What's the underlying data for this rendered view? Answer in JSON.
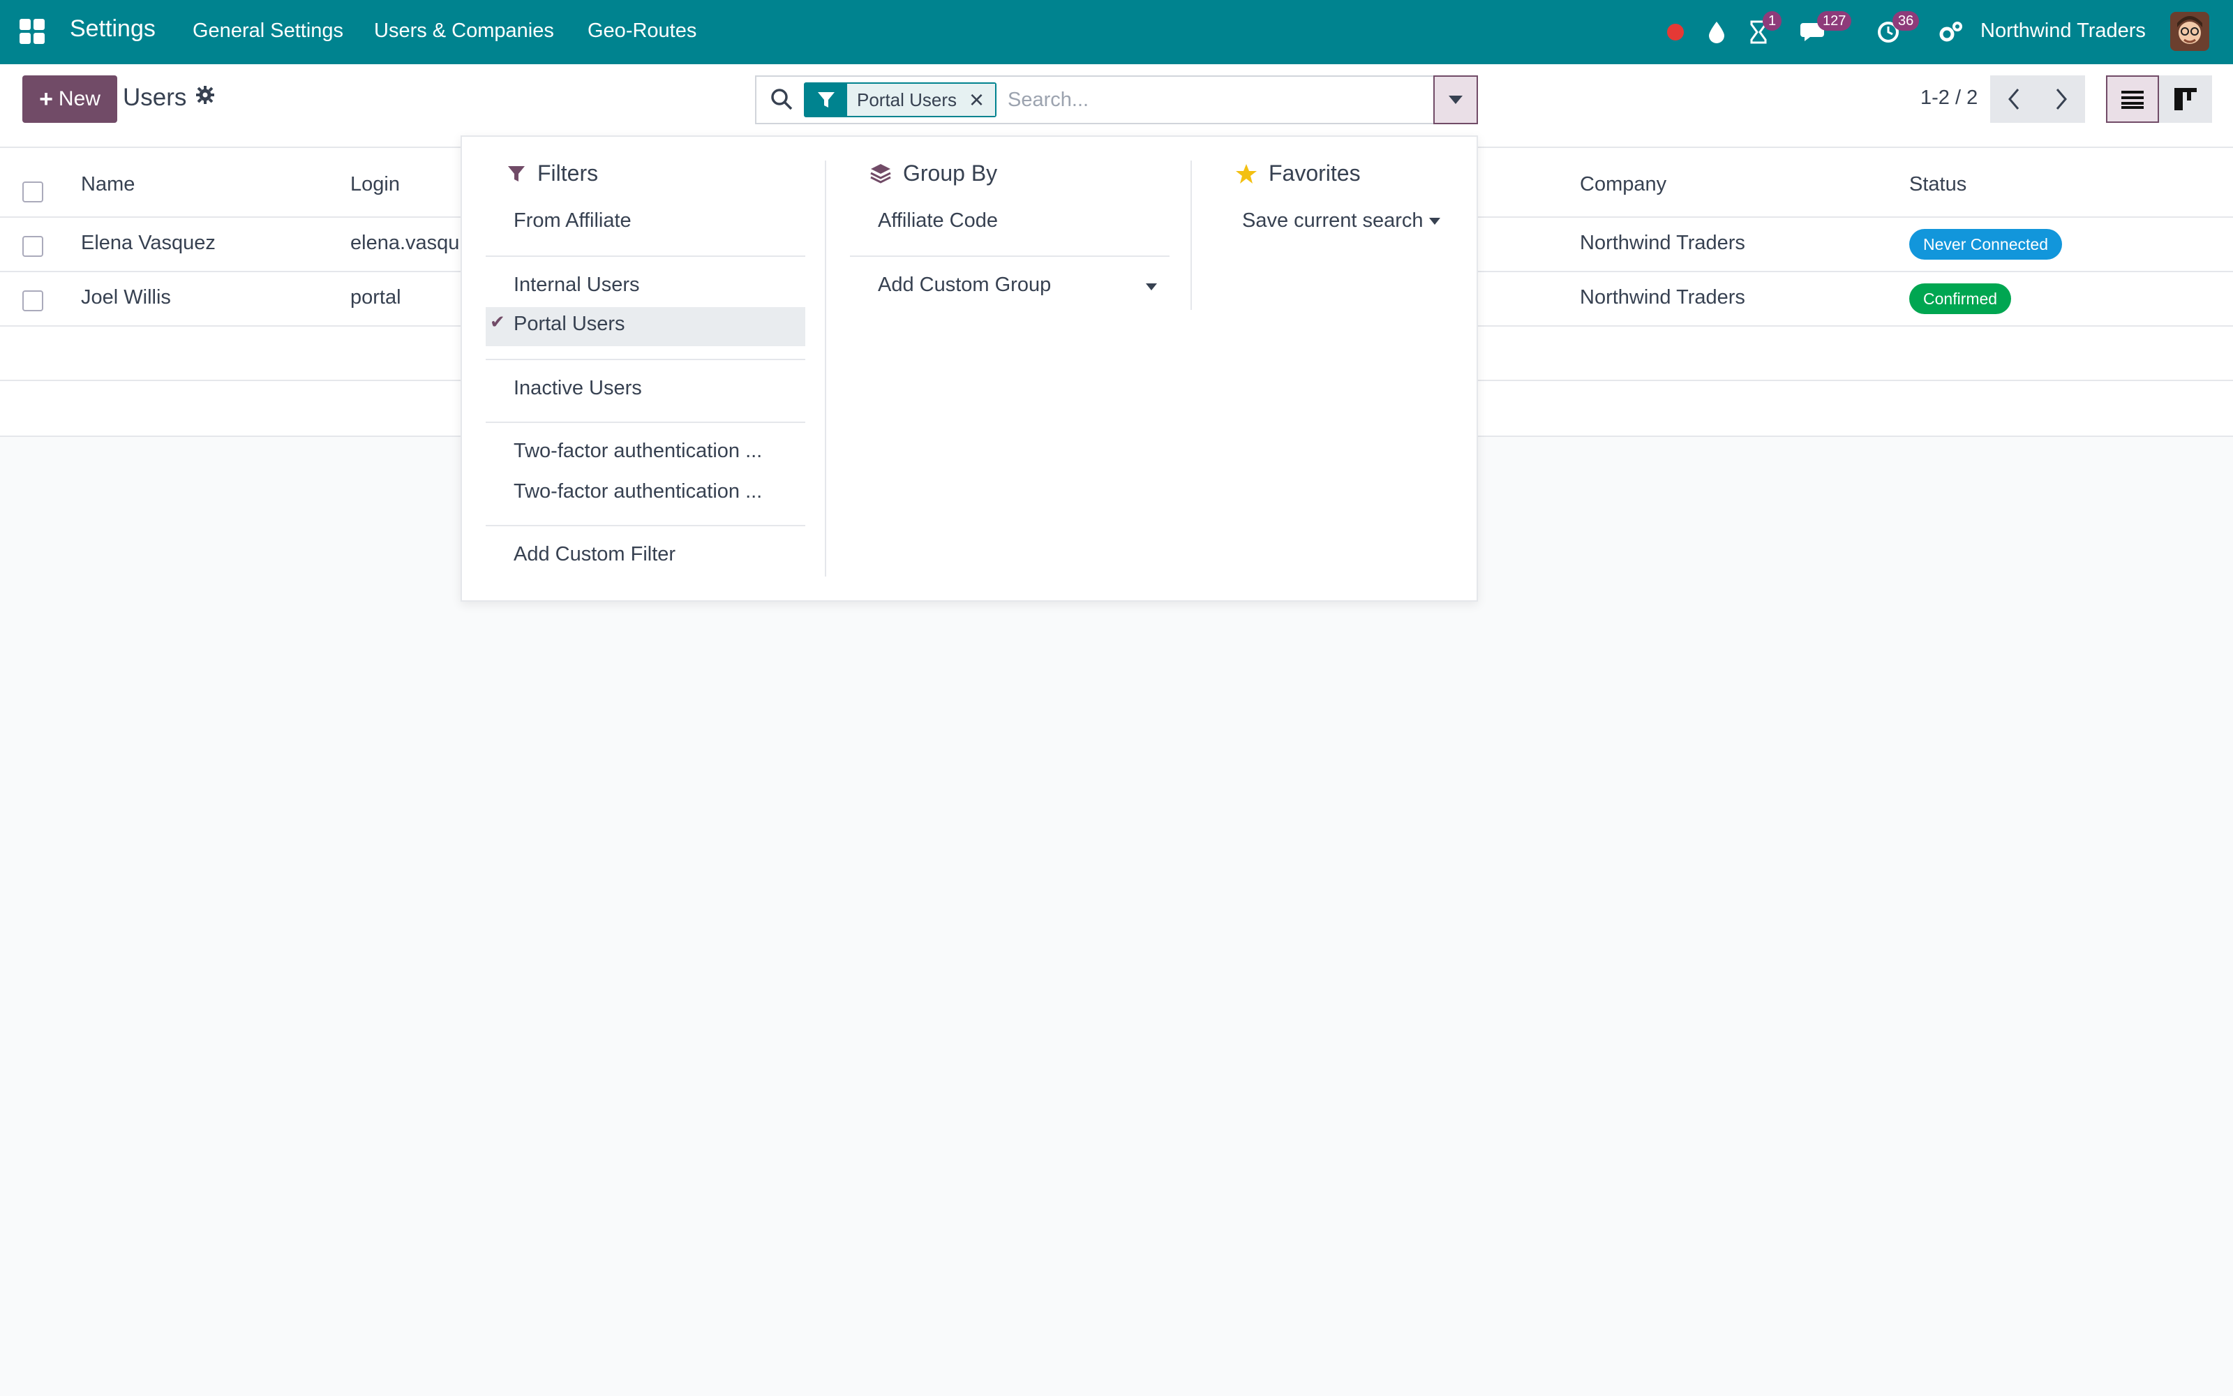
{
  "navbar": {
    "app_title": "Settings",
    "menu": [
      "General Settings",
      "Users & Companies",
      "Geo-Routes"
    ],
    "activity_badge": "1",
    "messages_badge": "127",
    "clock_badge": "36",
    "company": "Northwind Traders",
    "icons": [
      "apps-icon",
      "record-dot-icon",
      "droplet-icon",
      "hourglass-icon",
      "chat-icon",
      "clock-icon",
      "cogs-icon",
      "avatar"
    ],
    "brand_color": "#00838f"
  },
  "control_panel": {
    "new_label": "New",
    "title": "Users",
    "search": {
      "facet_label": "Portal Users",
      "placeholder": "Search..."
    },
    "pager": "1-2 / 2"
  },
  "list": {
    "headers": {
      "name": "Name",
      "login": "Login",
      "company": "Company",
      "status": "Status"
    },
    "rows": [
      {
        "name": "Elena Vasquez",
        "login": "elena.vasqu",
        "company": "Northwind Traders",
        "status": "Never Connected",
        "status_color": "#1296db"
      },
      {
        "name": "Joel Willis",
        "login": "portal",
        "company": "Northwind Traders",
        "status": "Confirmed",
        "status_color": "#00a651"
      }
    ]
  },
  "dropdown": {
    "filters_title": "Filters",
    "groupby_title": "Group By",
    "favorites_title": "Favorites",
    "filters": {
      "from_affiliate": "From Affiliate",
      "internal_users": "Internal Users",
      "portal_users": "Portal Users",
      "inactive_users": "Inactive Users",
      "two_factor_1": "Two-factor authentication ...",
      "two_factor_2": "Two-factor authentication ...",
      "add_custom_filter": "Add Custom Filter"
    },
    "groupby": {
      "affiliate_code": "Affiliate Code",
      "add_custom_group": "Add Custom Group"
    },
    "favorites": {
      "save_current_search": "Save current search"
    },
    "accent_color": "#714b67"
  }
}
